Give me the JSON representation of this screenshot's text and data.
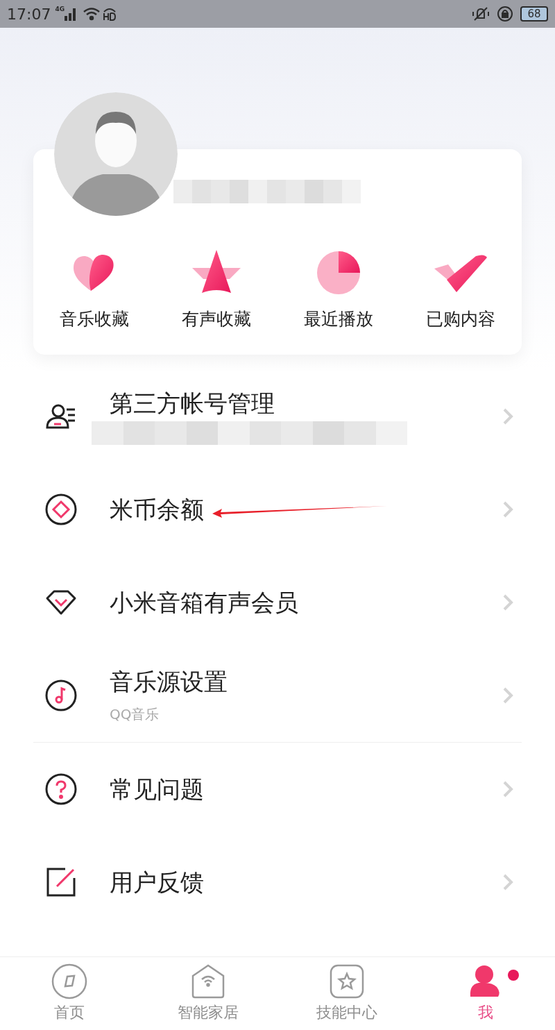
{
  "status_bar": {
    "time": "17:07",
    "network": "4G",
    "battery": "68"
  },
  "quick_links": [
    {
      "kind": "heart",
      "label": "音乐收藏"
    },
    {
      "kind": "star",
      "label": "有声收藏"
    },
    {
      "kind": "pie",
      "label": "最近播放"
    },
    {
      "kind": "check",
      "label": "已购内容"
    }
  ],
  "menu_sections": [
    [
      {
        "kind": "account",
        "title": "第三方帐号管理",
        "redacted": true
      },
      {
        "kind": "coin",
        "title": "米币余额",
        "annotated": true
      },
      {
        "kind": "vip",
        "title": "小米音箱有声会员"
      },
      {
        "kind": "music",
        "title": "音乐源设置",
        "subtitle": "QQ音乐"
      }
    ],
    [
      {
        "kind": "help",
        "title": "常见问题"
      },
      {
        "kind": "feedback",
        "title": "用户反馈"
      }
    ]
  ],
  "tabs": [
    {
      "kind": "home",
      "label": "首页",
      "selected": false,
      "dot": false
    },
    {
      "kind": "smarthome",
      "label": "智能家居",
      "selected": false,
      "dot": false
    },
    {
      "kind": "skills",
      "label": "技能中心",
      "selected": false,
      "dot": false
    },
    {
      "kind": "me",
      "label": "我",
      "selected": true,
      "dot": true
    }
  ]
}
